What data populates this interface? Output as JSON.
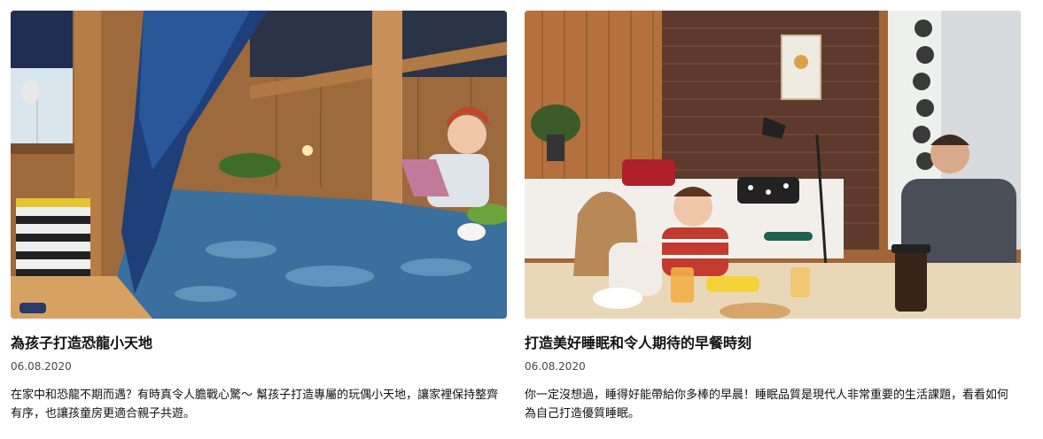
{
  "articles": [
    {
      "title": "為孩子打造恐龍小天地",
      "date": "06.08.2020",
      "description": "在家中和恐龍不期而遇？有時真令人膽戰心驚～ 幫孩子打造專屬的玩偶小天地，讓家裡保持整齊有序，也讓孩童房更適合親子共遊。"
    },
    {
      "title": "打造美好睡眠和令人期待的早餐時刻",
      "date": "06.08.2020",
      "description": "你一定沒想過，睡得好能帶給你多棒的早晨！睡眠品質是現代人非常重要的生活課題，看看如何為自己打造優質睡眠。"
    }
  ]
}
